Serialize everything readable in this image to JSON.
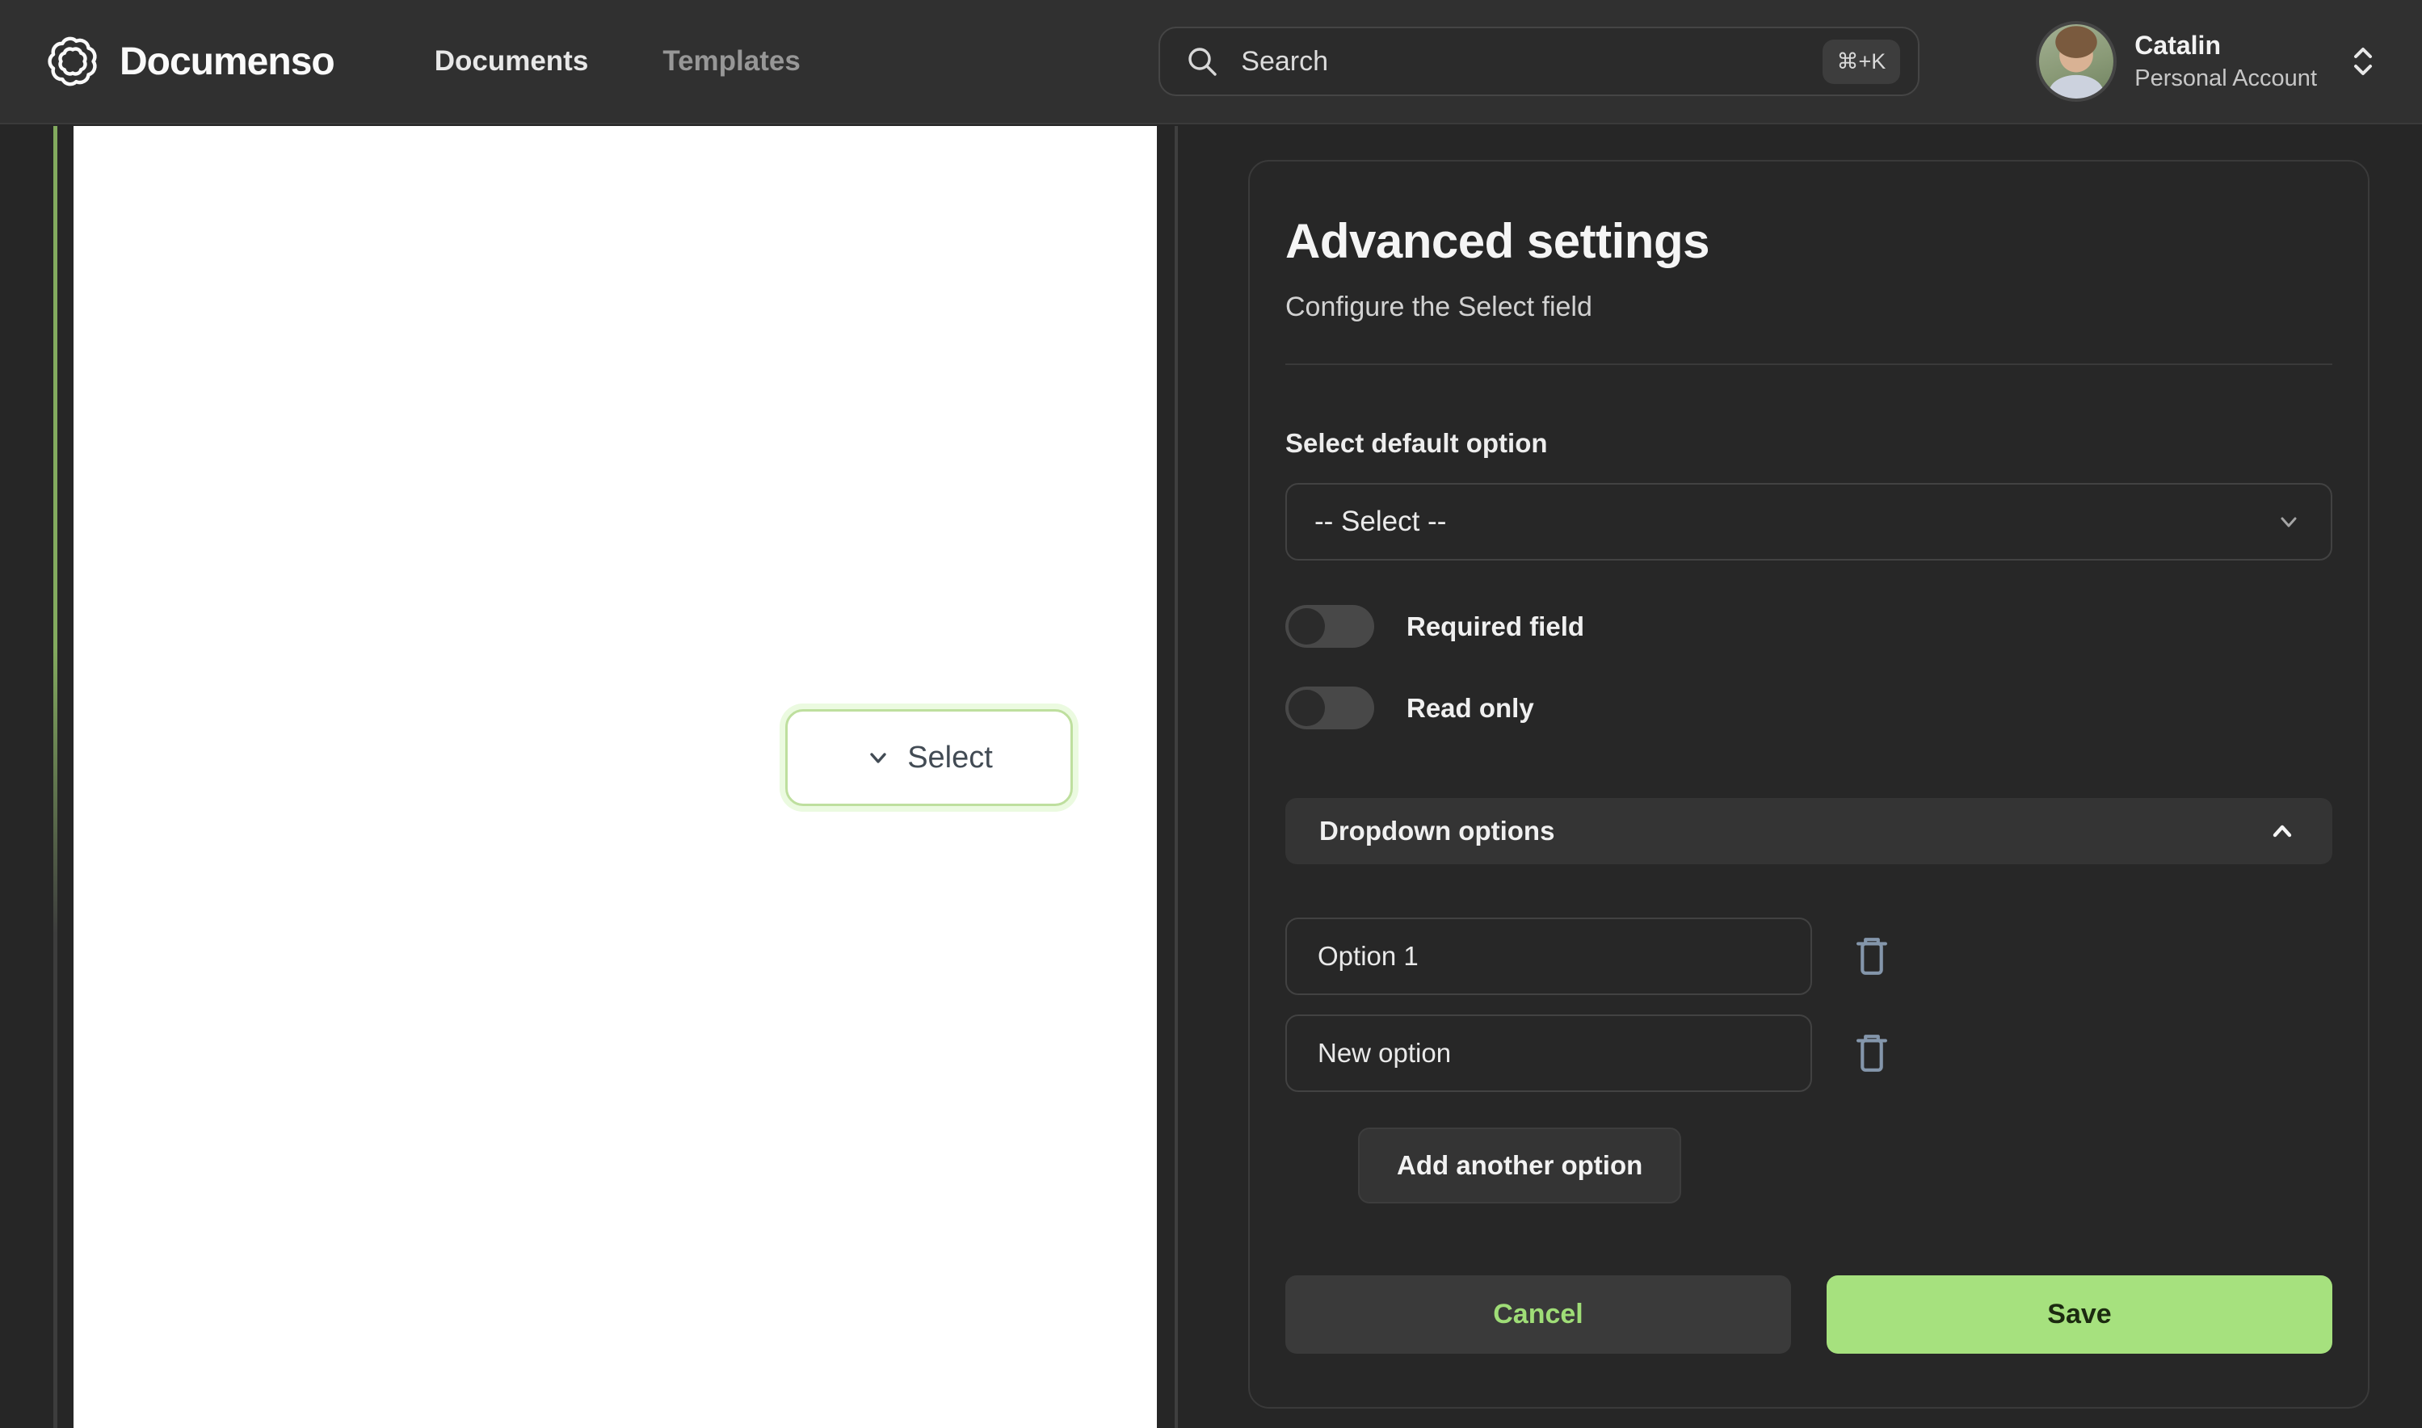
{
  "brand": {
    "name": "Documenso"
  },
  "nav": {
    "items": [
      {
        "label": "Documents",
        "active": true
      },
      {
        "label": "Templates",
        "active": false
      }
    ]
  },
  "search": {
    "placeholder": "Search",
    "shortcut": "⌘+K"
  },
  "user": {
    "name": "Catalin",
    "account_type": "Personal Account"
  },
  "document": {
    "field": {
      "label": "Select"
    }
  },
  "panel": {
    "title": "Advanced settings",
    "subtitle": "Configure the Select field",
    "default_option": {
      "label": "Select default option",
      "value": "-- Select --"
    },
    "toggles": [
      {
        "label": "Required field",
        "state": "off"
      },
      {
        "label": "Read only",
        "state": "off"
      }
    ],
    "dropdown_section": {
      "label": "Dropdown options",
      "expanded": true
    },
    "options": [
      {
        "value": "Option 1"
      },
      {
        "value": "New option"
      }
    ],
    "add_button_label": "Add another option",
    "cancel_label": "Cancel",
    "save_label": "Save"
  },
  "colors": {
    "accent_green": "#a6e17e",
    "accent_green_text": "#9fdd77",
    "save_text": "#1c2a10",
    "field_border_green": "#bedf9e",
    "rail_green": "#82aa5e",
    "trash_icon": "#8496ab",
    "navbar_bg": "#303030",
    "content_bg": "#262626",
    "panel_border": "#3a3a3a"
  }
}
